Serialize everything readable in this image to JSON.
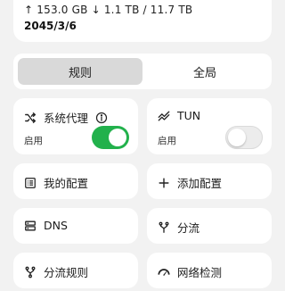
{
  "info": {
    "traffic": "↑ 153.0 GB ↓ 1.1 TB / 11.7 TB",
    "expire": "2045/3/6"
  },
  "segment": {
    "rule_label": "规则",
    "global_label": "全局",
    "selected": "规则"
  },
  "system_proxy": {
    "title": "系统代理",
    "status": "启用",
    "enabled": true
  },
  "tun": {
    "title": "TUN",
    "status": "启用",
    "enabled": false
  },
  "tiles": {
    "my_config": "我的配置",
    "add_config": "添加配置",
    "dns": "DNS",
    "split": "分流",
    "split_rules": "分流规则",
    "network_check": "网络检测"
  },
  "colors": {
    "accent_green": "#22b14c",
    "background": "#f2f2f2",
    "card": "#ffffff"
  }
}
